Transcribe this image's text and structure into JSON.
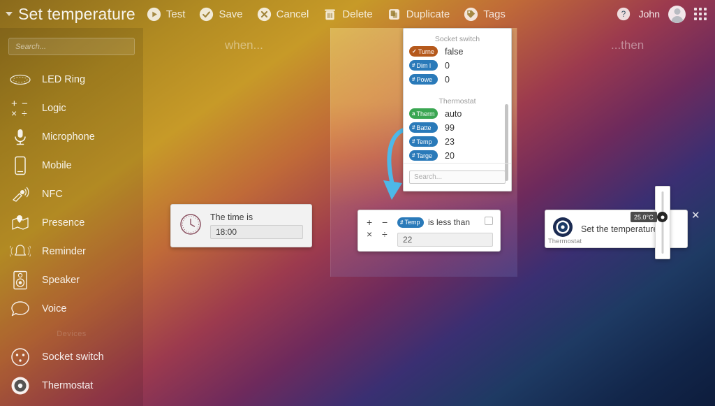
{
  "app": {
    "title": "Set temperature",
    "caret_icon": "chevron-down-icon"
  },
  "toolbar": {
    "items": [
      {
        "label": "Test",
        "icon": "play-icon"
      },
      {
        "label": "Save",
        "icon": "check-circle-icon"
      },
      {
        "label": "Cancel",
        "icon": "x-circle-icon"
      },
      {
        "label": "Delete",
        "icon": "trash-icon"
      },
      {
        "label": "Duplicate",
        "icon": "copy-icon"
      },
      {
        "label": "Tags",
        "icon": "tag-icon"
      }
    ],
    "help_icon": "question-circle-icon",
    "user_name": "John",
    "avatar_icon": "avatar-icon",
    "apps_grid_icon": "apps-grid-icon"
  },
  "sidebar": {
    "search_placeholder": "Search...",
    "items": [
      {
        "label": "LED Ring",
        "icon": "led-ring-icon"
      },
      {
        "label": "Logic",
        "icon": "logic-icon"
      },
      {
        "label": "Microphone",
        "icon": "microphone-icon"
      },
      {
        "label": "Mobile",
        "icon": "mobile-icon"
      },
      {
        "label": "NFC",
        "icon": "nfc-icon"
      },
      {
        "label": "Presence",
        "icon": "presence-icon"
      },
      {
        "label": "Reminder",
        "icon": "reminder-icon"
      },
      {
        "label": "Speaker",
        "icon": "speaker-icon"
      },
      {
        "label": "Voice",
        "icon": "voice-icon"
      }
    ],
    "section_label": "Devices",
    "devices": [
      {
        "label": "Socket switch",
        "icon": "socket-switch-icon"
      },
      {
        "label": "Thermostat",
        "icon": "thermostat-icon"
      }
    ]
  },
  "columns": {
    "when_label": "when...",
    "then_label": "...then"
  },
  "variable_panel": {
    "groups": [
      {
        "title": "Socket switch",
        "rows": [
          {
            "name": "Turne",
            "value": "false",
            "type": "bool",
            "symbol": "✓"
          },
          {
            "name": "Dim l",
            "value": "0",
            "type": "num",
            "symbol": "#"
          },
          {
            "name": "Powe",
            "value": "0",
            "type": "num",
            "symbol": "#"
          }
        ]
      },
      {
        "title": "Thermostat",
        "rows": [
          {
            "name": "Therm",
            "value": "auto",
            "type": "str",
            "symbol": "a"
          },
          {
            "name": "Batte",
            "value": "99",
            "type": "num",
            "symbol": "#"
          },
          {
            "name": "Temp",
            "value": "23",
            "type": "sel",
            "symbol": "#"
          },
          {
            "name": "Targe",
            "value": "20",
            "type": "num",
            "symbol": "#"
          }
        ]
      }
    ],
    "search_placeholder": "Search..."
  },
  "cards": {
    "time": {
      "icon": "clock-icon",
      "title": "The time is",
      "value": "18:00"
    },
    "condition": {
      "operators": [
        "+",
        "−",
        "×",
        "÷"
      ],
      "pill_label": "Temp",
      "pill_symbol": "#",
      "text": "is less than",
      "value": "22",
      "checkbox_checked": false
    },
    "action": {
      "icon": "thermostat-icon",
      "label": "Set the temperature",
      "device": "Thermostat",
      "slider_value": "25.0°C",
      "timer_icon": "stopwatch-icon",
      "close_icon": "close-icon"
    }
  },
  "colors": {
    "pill_number": "#2a7ab9",
    "pill_boolean": "#b5591c",
    "pill_string": "#3aa652",
    "arrow": "#4db8e8",
    "tooltip_bg": "#4b4b4b"
  }
}
